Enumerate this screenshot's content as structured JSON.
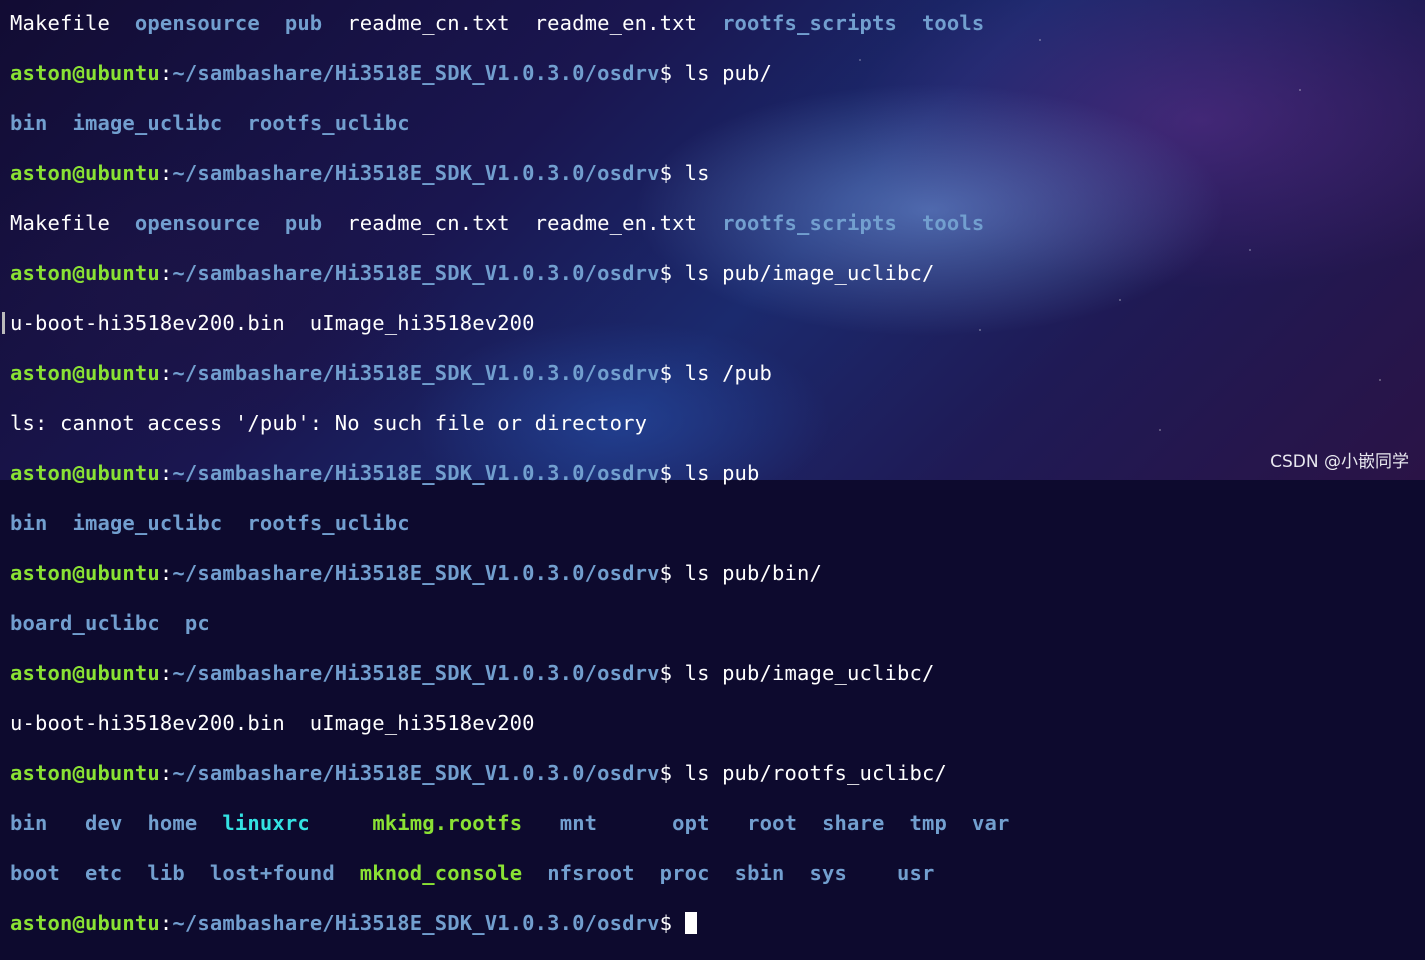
{
  "prompt": {
    "user": "aston@ubuntu",
    "sep": ":",
    "path": "~/sambashare/Hi3518E_SDK_V1.0.3.0/osdrv",
    "sign": "$ "
  },
  "lines": {
    "l0": {
      "a": "Makefile  ",
      "b": "opensource",
      "c": "  ",
      "d": "pub",
      "e": "  readme_cn.txt  readme_en.txt  ",
      "f": "rootfs_scripts",
      "g": "  ",
      "h": "tools"
    },
    "cmd1": "ls pub/",
    "out1": {
      "a": "bin",
      "b": "image_uclibc",
      "c": "rootfs_uclibc"
    },
    "cmd2": "ls",
    "out2": {
      "a": "Makefile  ",
      "b": "opensource",
      "c": "pub",
      "d": "  readme_cn.txt  readme_en.txt  ",
      "e": "rootfs_scripts",
      "f": "tools"
    },
    "cmd3": "ls pub/image_uclibc/",
    "out3": "u-boot-hi3518ev200.bin  uImage_hi3518ev200",
    "cmd4": "ls /pub",
    "out4": "ls: cannot access '/pub': No such file or directory",
    "cmd5": "ls pub",
    "out5": {
      "a": "bin",
      "b": "image_uclibc",
      "c": "rootfs_uclibc"
    },
    "cmd6": "ls pub/bin/",
    "out6": {
      "a": "board_uclibc",
      "b": "pc"
    },
    "cmd7": "ls pub/image_uclibc/",
    "out7": "u-boot-hi3518ev200.bin  uImage_hi3518ev200",
    "cmd8": "ls pub/rootfs_uclibc/",
    "out8a": {
      "c1": "bin",
      "c2": "dev",
      "c3": "home",
      "c4": "linuxrc",
      "c5": "mkimg.rootfs",
      "c6": "mnt",
      "c7": "opt",
      "c8": "root",
      "c9": "share",
      "c10": "tmp",
      "c11": "var"
    },
    "out8b": {
      "c1": "boot",
      "c2": "etc",
      "c3": "lib",
      "c4": "lost+found",
      "c5": "mknod_console",
      "c6": "nfsroot",
      "c7": "proc",
      "c8": "sbin",
      "c9": "sys",
      "c10": "usr"
    }
  },
  "watermark": "CSDN @小嵌同学",
  "colors": {
    "prompt_user": "#8ae234",
    "prompt_path": "#729fcf",
    "directory": "#729fcf",
    "executable": "#8ae234",
    "symlink": "#34e2e2",
    "text": "#ffffff"
  }
}
